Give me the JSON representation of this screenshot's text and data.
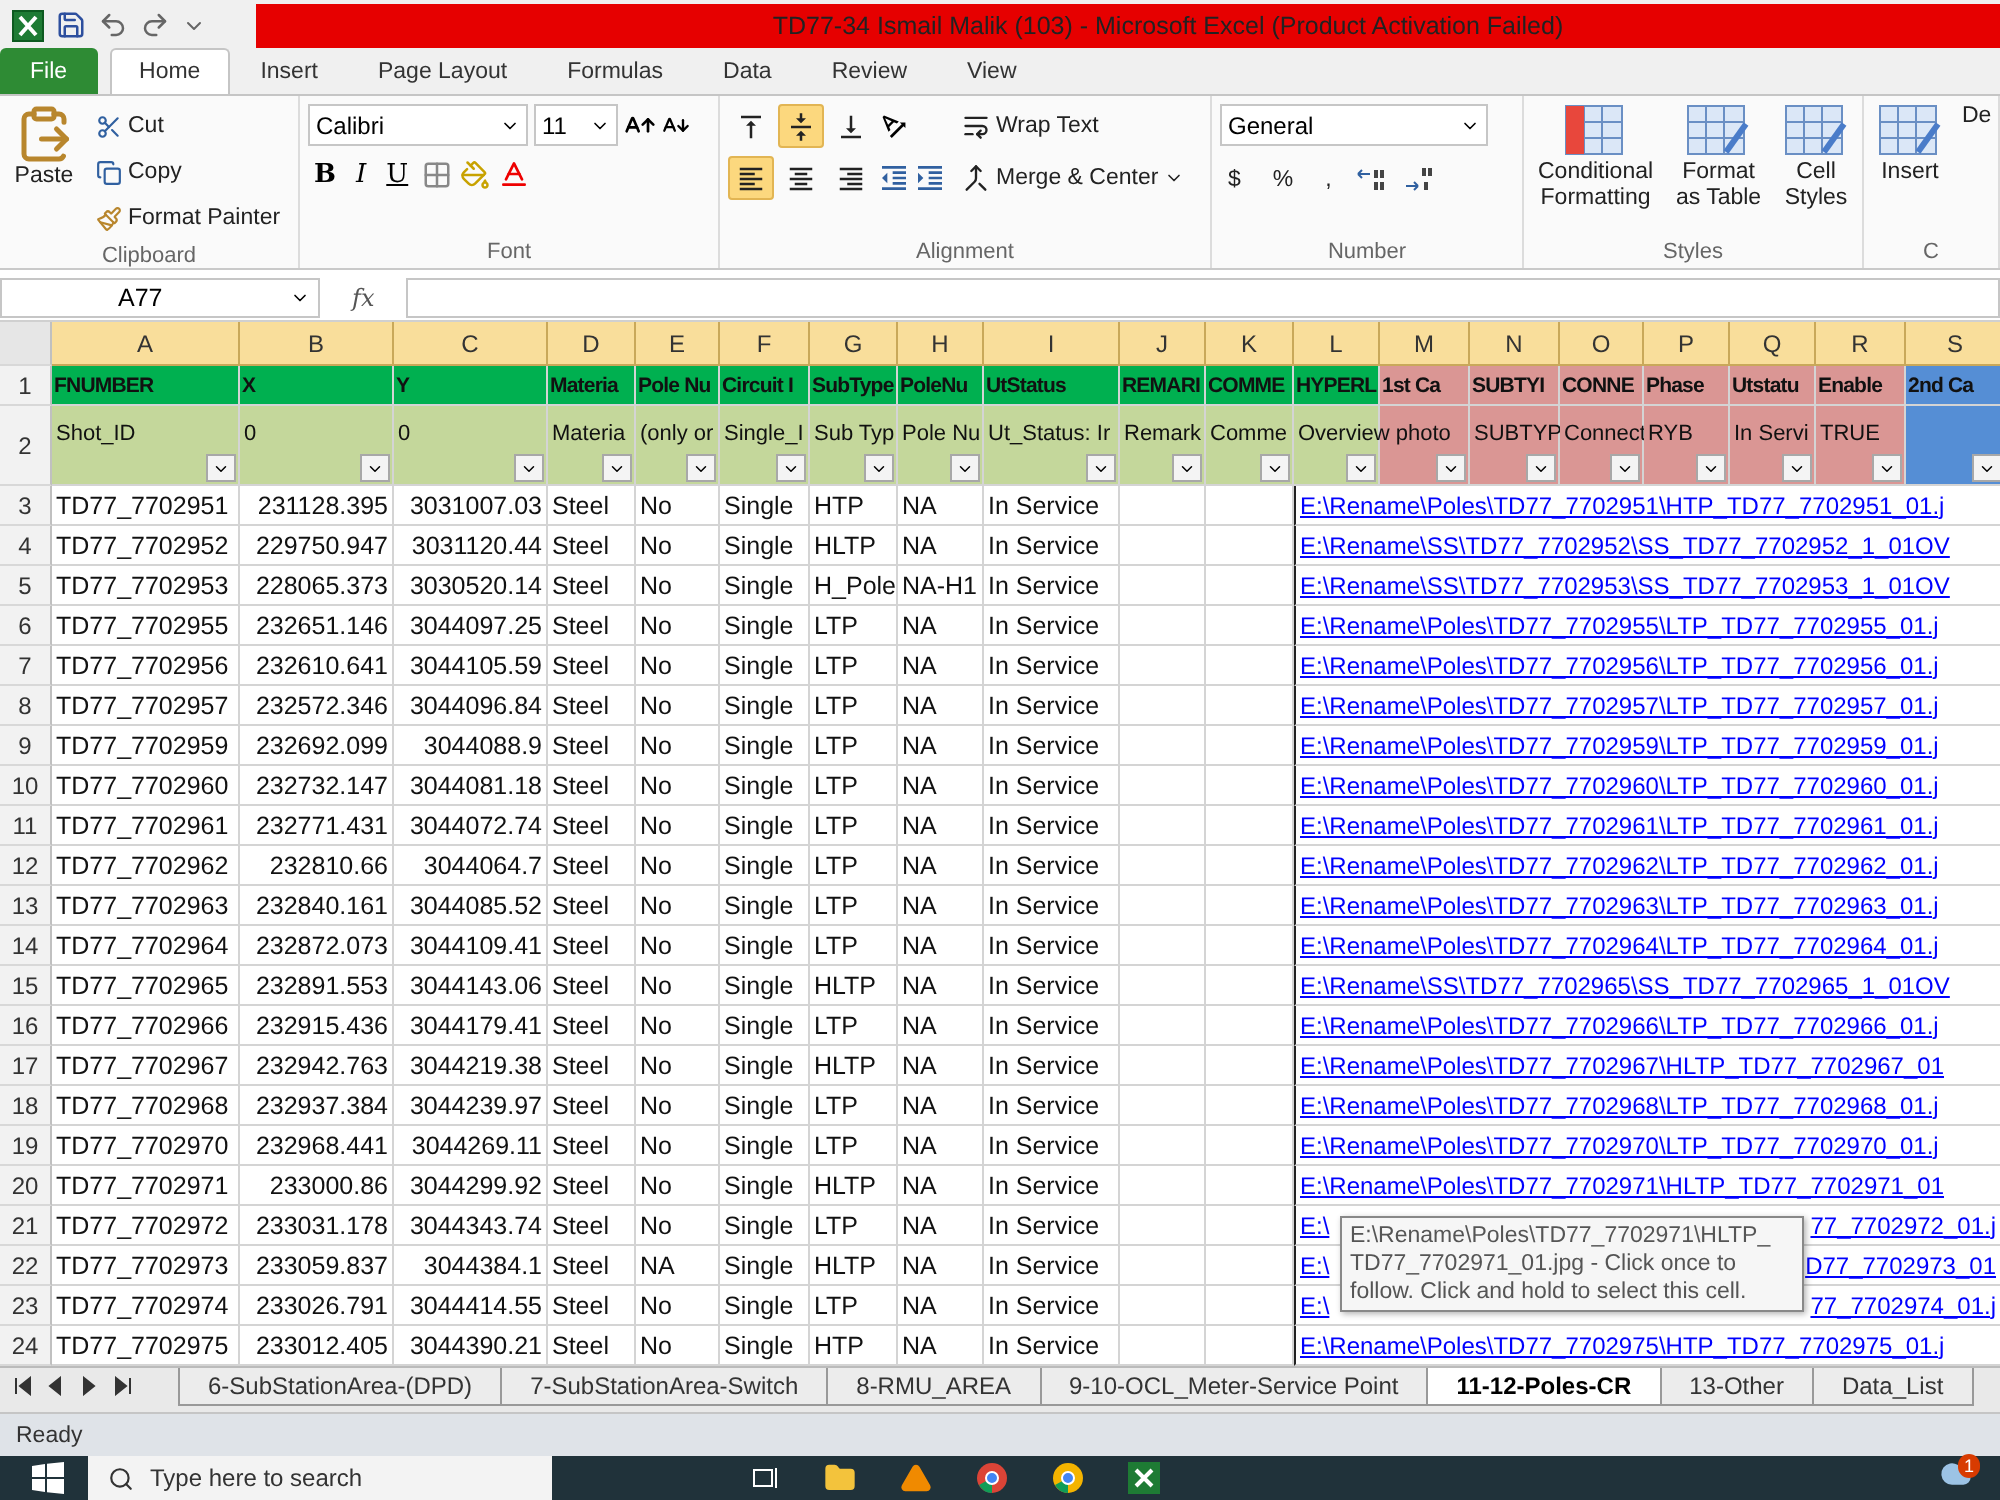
{
  "window": {
    "title": "TD77-34 Ismail Malik (103)  -  Microsoft Excel (Product Activation Failed)"
  },
  "ribbon_tabs": [
    {
      "label": "File",
      "kind": "file",
      "selected": false
    },
    {
      "label": "Home",
      "kind": "tab",
      "selected": true
    },
    {
      "label": "Insert",
      "kind": "tab",
      "selected": false
    },
    {
      "label": "Page Layout",
      "kind": "tab",
      "selected": false
    },
    {
      "label": "Formulas",
      "kind": "tab",
      "selected": false
    },
    {
      "label": "Data",
      "kind": "tab",
      "selected": false
    },
    {
      "label": "Review",
      "kind": "tab",
      "selected": false
    },
    {
      "label": "View",
      "kind": "tab",
      "selected": false
    }
  ],
  "ribbon": {
    "clipboard": {
      "label": "Clipboard",
      "paste": "Paste",
      "cut": "Cut",
      "copy": "Copy",
      "format_painter": "Format Painter"
    },
    "font": {
      "label": "Font",
      "name": "Calibri",
      "size": "11",
      "bold": "B",
      "italic": "I",
      "underline": "U"
    },
    "alignment": {
      "label": "Alignment",
      "wrap": "Wrap Text",
      "merge": "Merge & Center",
      "buttons": [
        {
          "kind": "top",
          "selected": false
        },
        {
          "kind": "middle",
          "selected": true
        },
        {
          "kind": "bottom",
          "selected": false
        },
        {
          "kind": "left",
          "selected": true
        },
        {
          "kind": "center",
          "selected": false
        },
        {
          "kind": "right",
          "selected": false
        }
      ]
    },
    "number": {
      "label": "Number",
      "format": "General",
      "currency": "$",
      "percent": "%",
      "comma": ","
    },
    "styles": {
      "label": "Styles",
      "conditional": "Conditional Formatting",
      "table": "Format as Table",
      "cell_styles": "Cell Styles"
    },
    "cells": {
      "label": "C",
      "insert": "Insert",
      "delete": "De"
    }
  },
  "formula_bar": {
    "name_box": "A77",
    "fx": "fx"
  },
  "header_rows": [
    "1",
    "2"
  ],
  "columns": [
    {
      "letter": "A",
      "title": "FNUMBER",
      "sub": "Shot_ID",
      "color": "#00b050"
    },
    {
      "letter": "B",
      "title": "X",
      "sub": "0",
      "color": "#00b050"
    },
    {
      "letter": "C",
      "title": "Y",
      "sub": "0",
      "color": "#00b050"
    },
    {
      "letter": "D",
      "title": "Materia",
      "sub": "Materia",
      "color": "#00b050"
    },
    {
      "letter": "E",
      "title": "Pole Nu",
      "sub": "(only or",
      "color": "#00b050"
    },
    {
      "letter": "F",
      "title": "Circuit I",
      "sub": "Single_I",
      "color": "#00b050"
    },
    {
      "letter": "G",
      "title": "SubType",
      "sub": "Sub Typ",
      "color": "#00b050"
    },
    {
      "letter": "H",
      "title": "PoleNu",
      "sub": "Pole Nu",
      "color": "#00b050"
    },
    {
      "letter": "I",
      "title": "UtStatus",
      "sub": "Ut_Status: Ir",
      "color": "#00b050"
    },
    {
      "letter": "J",
      "title": "REMARI",
      "sub": "Remark",
      "color": "#00b050"
    },
    {
      "letter": "K",
      "title": "COMME",
      "sub": "Comme",
      "color": "#00b050"
    },
    {
      "letter": "L",
      "title": "HYPERL",
      "sub": "Overview photo",
      "color": "#00b050"
    },
    {
      "letter": "M",
      "title": "1st Ca",
      "color": "#da9694"
    },
    {
      "letter": "N",
      "title": "SUBTYI",
      "sub": "SUBTYP",
      "color": "#da9694"
    },
    {
      "letter": "O",
      "title": "CONNE",
      "sub": "Connect",
      "color": "#da9694"
    },
    {
      "letter": "P",
      "title": "Phase",
      "sub": "RYB",
      "color": "#da9694"
    },
    {
      "letter": "Q",
      "title": "Utstatu",
      "sub": "In Servi",
      "color": "#da9694"
    },
    {
      "letter": "R",
      "title": "Enable",
      "sub": "TRUE",
      "color": "#da9694"
    },
    {
      "letter": "S",
      "title": "2nd Ca",
      "color": "#558ed5"
    }
  ],
  "rows": [
    {
      "num": "3",
      "cells": [
        "TD77_7702951",
        "231128.395",
        "3031007.03",
        "Steel",
        "No",
        "Single",
        "HTP",
        "NA",
        "In Service"
      ],
      "link": [
        "E:\\Rename\\Poles\\TD77_7702951\\HTP_TD77_7702951_01.j"
      ]
    },
    {
      "num": "4",
      "cells": [
        "TD77_7702952",
        "229750.947",
        "3031120.44",
        "Steel",
        "No",
        "Single",
        "HLTP",
        "NA",
        "In Service"
      ],
      "link": [
        "E:\\Rename\\SS\\TD77_7702952\\SS_TD77_7702952_1_01OV"
      ]
    },
    {
      "num": "5",
      "cells": [
        "TD77_7702953",
        "228065.373",
        "3030520.14",
        "Steel",
        "No",
        "Single",
        "H_Pole",
        "NA-H1",
        "In Service"
      ],
      "link": [
        "E:\\Rename\\SS\\TD77_7702953\\SS_TD77_7702953_1_01OV"
      ]
    },
    {
      "num": "6",
      "cells": [
        "TD77_7702955",
        "232651.146",
        "3044097.25",
        "Steel",
        "No",
        "Single",
        "LTP",
        "NA",
        "In Service"
      ],
      "link": [
        "E:\\Rename\\Poles\\TD77_7702955\\LTP_TD77_7702955_01.j"
      ]
    },
    {
      "num": "7",
      "cells": [
        "TD77_7702956",
        "232610.641",
        "3044105.59",
        "Steel",
        "No",
        "Single",
        "LTP",
        "NA",
        "In Service"
      ],
      "link": [
        "E:\\Rename\\Poles\\TD77_7702956\\LTP_TD77_7702956_01.j"
      ]
    },
    {
      "num": "8",
      "cells": [
        "TD77_7702957",
        "232572.346",
        "3044096.84",
        "Steel",
        "No",
        "Single",
        "LTP",
        "NA",
        "In Service"
      ],
      "link": [
        "E:\\Rename\\Poles\\TD77_7702957\\LTP_TD77_7702957_01.j"
      ]
    },
    {
      "num": "9",
      "cells": [
        "TD77_7702959",
        "232692.099",
        "3044088.9",
        "Steel",
        "No",
        "Single",
        "LTP",
        "NA",
        "In Service"
      ],
      "link": [
        "E:\\Rename\\Poles\\TD77_7702959\\LTP_TD77_7702959_01.j"
      ]
    },
    {
      "num": "10",
      "cells": [
        "TD77_7702960",
        "232732.147",
        "3044081.18",
        "Steel",
        "No",
        "Single",
        "LTP",
        "NA",
        "In Service"
      ],
      "link": [
        "E:\\Rename\\Poles\\TD77_7702960\\LTP_TD77_7702960_01.j"
      ]
    },
    {
      "num": "11",
      "cells": [
        "TD77_7702961",
        "232771.431",
        "3044072.74",
        "Steel",
        "No",
        "Single",
        "LTP",
        "NA",
        "In Service"
      ],
      "link": [
        "E:\\Rename\\Poles\\TD77_7702961\\LTP_TD77_7702961_01.j"
      ]
    },
    {
      "num": "12",
      "cells": [
        "TD77_7702962",
        "232810.66",
        "3044064.7",
        "Steel",
        "No",
        "Single",
        "LTP",
        "NA",
        "In Service"
      ],
      "link": [
        "E:\\Rename\\Poles\\TD77_7702962\\LTP_TD77_7702962_01.j"
      ]
    },
    {
      "num": "13",
      "cells": [
        "TD77_7702963",
        "232840.161",
        "3044085.52",
        "Steel",
        "No",
        "Single",
        "LTP",
        "NA",
        "In Service"
      ],
      "link": [
        "E:\\Rename\\Poles\\TD77_7702963\\LTP_TD77_7702963_01.j"
      ]
    },
    {
      "num": "14",
      "cells": [
        "TD77_7702964",
        "232872.073",
        "3044109.41",
        "Steel",
        "No",
        "Single",
        "LTP",
        "NA",
        "In Service"
      ],
      "link": [
        "E:\\Rename\\Poles\\TD77_7702964\\LTP_TD77_7702964_01.j"
      ]
    },
    {
      "num": "15",
      "cells": [
        "TD77_7702965",
        "232891.553",
        "3044143.06",
        "Steel",
        "No",
        "Single",
        "HLTP",
        "NA",
        "In Service"
      ],
      "link": [
        "E:\\Rename\\SS\\TD77_7702965\\SS_TD77_7702965_1_01OV"
      ]
    },
    {
      "num": "16",
      "cells": [
        "TD77_7702966",
        "232915.436",
        "3044179.41",
        "Steel",
        "No",
        "Single",
        "LTP",
        "NA",
        "In Service"
      ],
      "link": [
        "E:\\Rename\\Poles\\TD77_7702966\\LTP_TD77_7702966_01.j"
      ]
    },
    {
      "num": "17",
      "cells": [
        "TD77_7702967",
        "232942.763",
        "3044219.38",
        "Steel",
        "No",
        "Single",
        "HLTP",
        "NA",
        "In Service"
      ],
      "link": [
        "E:\\Rename\\Poles\\TD77_7702967\\HLTP_TD77_7702967_01"
      ]
    },
    {
      "num": "18",
      "cells": [
        "TD77_7702968",
        "232937.384",
        "3044239.97",
        "Steel",
        "No",
        "Single",
        "LTP",
        "NA",
        "In Service"
      ],
      "link": [
        "E:\\Rename\\Poles\\TD77_7702968\\LTP_TD77_7702968_01.j"
      ]
    },
    {
      "num": "19",
      "cells": [
        "TD77_7702970",
        "232968.441",
        "3044269.11",
        "Steel",
        "No",
        "Single",
        "LTP",
        "NA",
        "In Service"
      ],
      "link": [
        "E:\\Rename\\Poles\\TD77_7702970\\LTP_TD77_7702970_01.j"
      ]
    },
    {
      "num": "20",
      "cells": [
        "TD77_7702971",
        "233000.86",
        "3044299.92",
        "Steel",
        "No",
        "Single",
        "HLTP",
        "NA",
        "In Service"
      ],
      "link": [
        "E:\\Rename\\Poles\\TD77_7702971\\HLTP_TD77_7702971_01"
      ]
    },
    {
      "num": "21",
      "cells": [
        "TD77_7702972",
        "233031.178",
        "3044343.74",
        "Steel",
        "No",
        "Single",
        "LTP",
        "NA",
        "In Service"
      ],
      "link": [
        "E:\\",
        "77_7702972_01.j"
      ]
    },
    {
      "num": "22",
      "cells": [
        "TD77_7702973",
        "233059.837",
        "3044384.1",
        "Steel",
        "NA",
        "Single",
        "HLTP",
        "NA",
        "In Service"
      ],
      "link": [
        "E:\\",
        "D77_7702973_01"
      ]
    },
    {
      "num": "23",
      "cells": [
        "TD77_7702974",
        "233026.791",
        "3044414.55",
        "Steel",
        "No",
        "Single",
        "LTP",
        "NA",
        "In Service"
      ],
      "link": [
        "E:\\",
        "77_7702974_01.j"
      ]
    },
    {
      "num": "24",
      "cells": [
        "TD77_7702975",
        "233012.405",
        "3044390.21",
        "Steel",
        "No",
        "Single",
        "HTP",
        "NA",
        "In Service"
      ],
      "link": [
        "E:\\Rename\\Poles\\TD77_7702975\\HTP_TD77_7702975_01.j"
      ]
    }
  ],
  "tooltip": "E:\\Rename\\Poles\\TD77_7702971\\HLTP_ TD77_7702971_01.jpg - Click once to follow. Click and hold to select this cell.",
  "sheet_tabs": [
    {
      "label": "6-SubStationArea-(DPD)",
      "selected": false
    },
    {
      "label": "7-SubStationArea-Switch",
      "selected": false
    },
    {
      "label": "8-RMU_AREA",
      "selected": false
    },
    {
      "label": "9-10-OCL_Meter-Service Point",
      "selected": false
    },
    {
      "label": "11-12-Poles-CR",
      "selected": true
    },
    {
      "label": "13-Other",
      "selected": false
    },
    {
      "label": "Data_List",
      "selected": false
    }
  ],
  "status_bar": {
    "text": "Ready"
  },
  "taskbar": {
    "search_placeholder": "Type here to search",
    "badge": "1"
  }
}
